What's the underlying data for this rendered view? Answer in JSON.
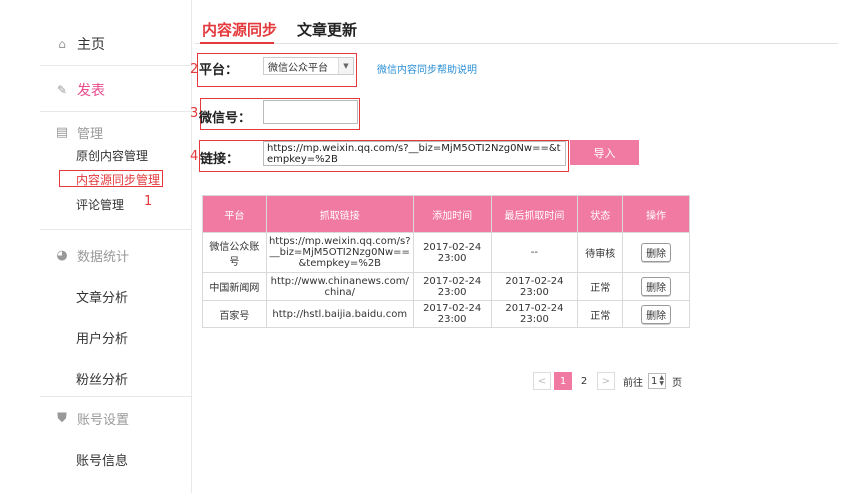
{
  "sidebar": {
    "home": "主页",
    "publish": "发表",
    "manage": "管理",
    "manage_items": [
      "原创内容管理",
      "内容源同步管理",
      "评论管理"
    ],
    "stats": "数据统计",
    "stats_items": [
      "文章分析",
      "用户分析",
      "粉丝分析"
    ],
    "account": "账号设置",
    "account_items": [
      "账号信息"
    ]
  },
  "tabs": [
    "内容源同步",
    "文章更新"
  ],
  "form": {
    "platform_label": "平台：",
    "platform_value": "微信公众平台",
    "help_link": "微信内容同步帮助说明",
    "wechat_label": "微信号：",
    "wechat_value": "",
    "link_label": "链接：",
    "link_value": "https://mp.weixin.qq.com/s?__biz=MjM5OTI2Nzg0Nw==&tempkey=%2B",
    "import_button": "导入"
  },
  "annotations": [
    "1",
    "2",
    "3",
    "4"
  ],
  "table": {
    "headers": [
      "平台",
      "抓取链接",
      "添加时间",
      "最后抓取时间",
      "状态",
      "操作"
    ],
    "rows": [
      {
        "platform": "微信公众账号",
        "url": "https://mp.weixin.qq.com/s?__biz=MjM5OTI2Nzg0Nw==&tempkey=%2B",
        "added": "2017-02-24 23:00",
        "last": "--",
        "status": "待审核",
        "action": "删除"
      },
      {
        "platform": "中国新闻网",
        "url": "http://www.chinanews.com/china/",
        "added": "2017-02-24 23:00",
        "last": "2017-02-24 23:00",
        "status": "正常",
        "action": "删除"
      },
      {
        "platform": "百家号",
        "url": "http://hstl.baijia.baidu.com",
        "added": "2017-02-24 23:00",
        "last": "2017-02-24 23:00",
        "status": "正常",
        "action": "删除"
      }
    ]
  },
  "pagination": {
    "prev": "<",
    "pages": [
      "1",
      "2"
    ],
    "next": ">",
    "goto_label": "前往",
    "goto_value": "1",
    "page_suffix": "页"
  }
}
